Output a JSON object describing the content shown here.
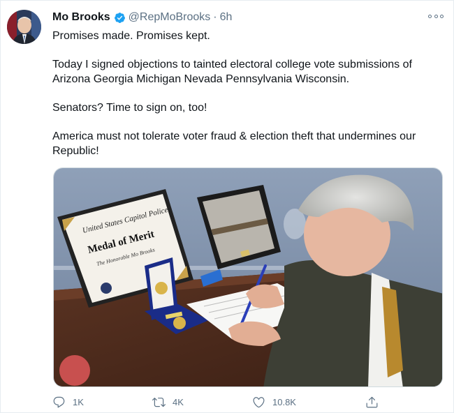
{
  "tweet": {
    "author_name": "Mo Brooks",
    "handle": "@RepMoBrooks",
    "separator": "·",
    "time": "6h",
    "paragraphs": [
      "Promises made. Promises kept.",
      "Today I signed objections to tainted electoral college vote submissions of Arizona Georgia Michigan Nevada Pennsylvania Wisconsin.",
      "Senators? Time to sign on, too!",
      "America must not tolerate voter fraud & election theft that undermines our Republic!"
    ]
  },
  "photo": {
    "plaque_line1": "United States Capitol Police",
    "plaque_line2": "Medal of Merit",
    "plaque_line3": "The Honorable Mo Brooks"
  },
  "actions": {
    "reply_count": "1K",
    "retweet_count": "4K",
    "like_count": "10.8K"
  },
  "colors": {
    "verified_blue": "#1da1f2",
    "secondary_text": "#5b7083"
  },
  "icons": [
    "verified-icon",
    "more-options-icon",
    "reply-icon",
    "retweet-icon",
    "like-icon",
    "share-icon"
  ]
}
